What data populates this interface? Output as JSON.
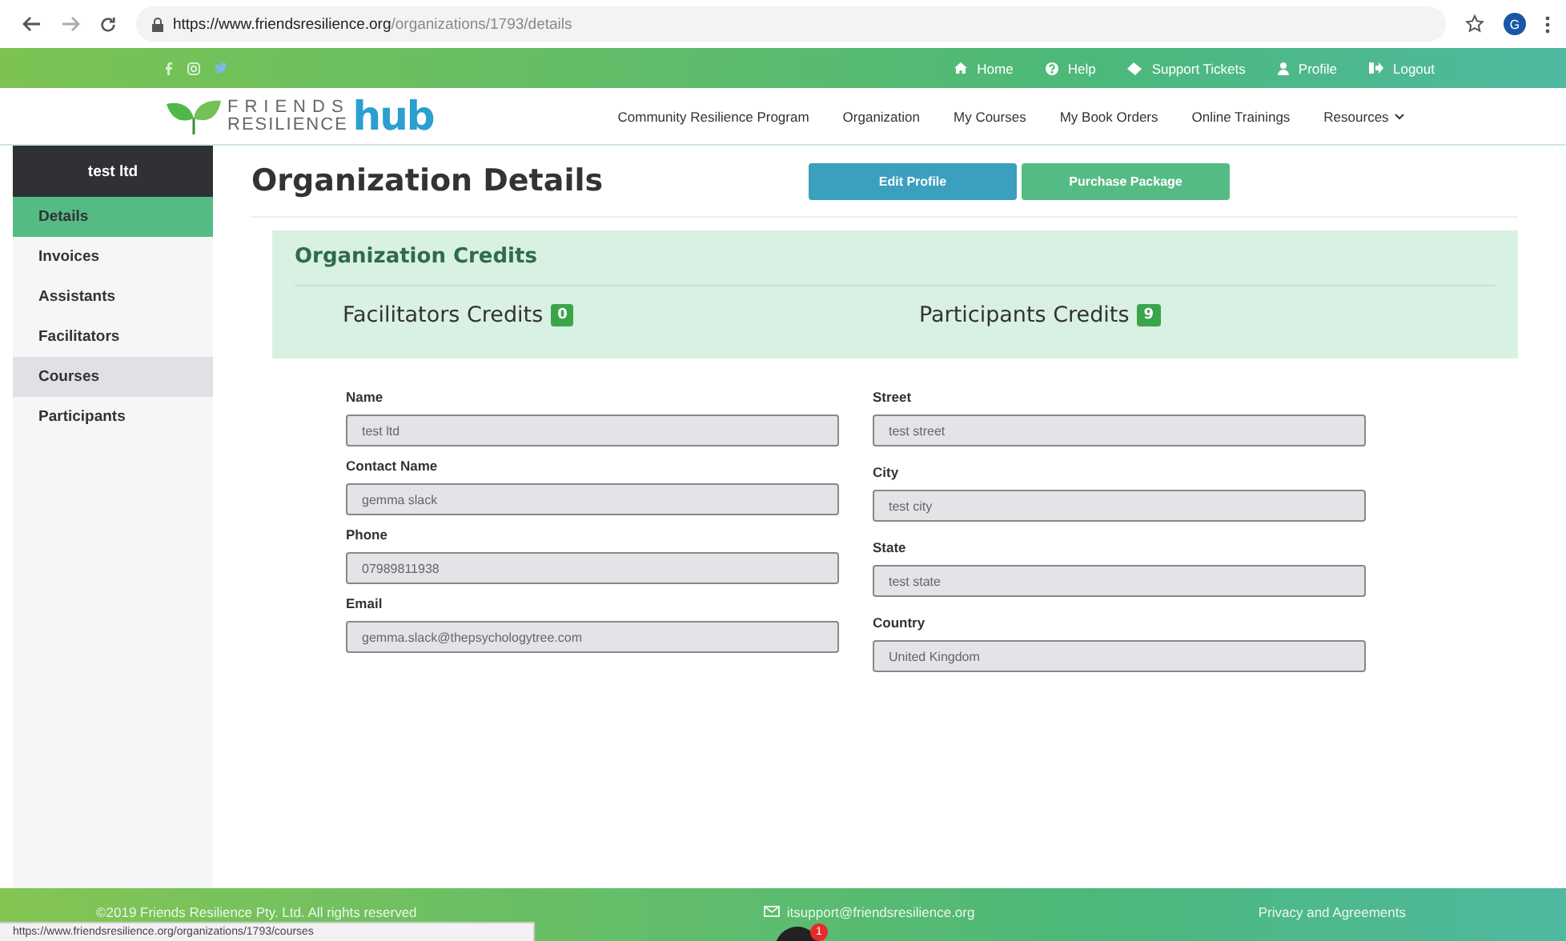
{
  "browser": {
    "url_host": "https://www.friendsresilience.org",
    "url_path": "/organizations/1793/details",
    "avatar": "G"
  },
  "top_bar": {
    "links": [
      {
        "label": "Home"
      },
      {
        "label": "Help"
      },
      {
        "label": "Support Tickets"
      },
      {
        "label": "Profile"
      },
      {
        "label": "Logout"
      }
    ]
  },
  "logo": {
    "line1": "FRIENDS",
    "line2": "RESILIENCE",
    "word": "hub"
  },
  "nav": [
    {
      "label": "Community Resilience Program",
      "dropdown": false
    },
    {
      "label": "Organization",
      "dropdown": false
    },
    {
      "label": "My Courses",
      "dropdown": false
    },
    {
      "label": "My Book Orders",
      "dropdown": false
    },
    {
      "label": "Online Trainings",
      "dropdown": false
    },
    {
      "label": "Resources",
      "dropdown": true
    }
  ],
  "sidebar": {
    "title": "test ltd",
    "items": [
      {
        "label": "Details",
        "selected": true,
        "hovered": false
      },
      {
        "label": "Invoices",
        "selected": false,
        "hovered": false
      },
      {
        "label": "Assistants",
        "selected": false,
        "hovered": false
      },
      {
        "label": "Facilitators",
        "selected": false,
        "hovered": false
      },
      {
        "label": "Courses",
        "selected": false,
        "hovered": true
      },
      {
        "label": "Participants",
        "selected": false,
        "hovered": false
      }
    ]
  },
  "page_title": "Organization Details",
  "buttons": [
    {
      "label": "Edit Profile",
      "kind": "info"
    },
    {
      "label": "Purchase Package",
      "kind": "success"
    }
  ],
  "credits": {
    "title": "Organization Credits",
    "items": [
      {
        "label": "Facilitators Credits",
        "count": "0"
      },
      {
        "label": "Participants Credits",
        "count": "9"
      }
    ]
  },
  "form": {
    "columns": [
      [
        {
          "label": "Name",
          "value": "test ltd"
        },
        {
          "label": "Contact Name",
          "value": "gemma slack"
        },
        {
          "label": "Phone",
          "value": "07989811938"
        },
        {
          "label": "Email",
          "value": "gemma.slack@thepsychologytree.com"
        }
      ],
      [
        {
          "label": "Street",
          "value": "test street"
        },
        {
          "label": "City",
          "value": "test city"
        },
        {
          "label": "State",
          "value": "test state"
        },
        {
          "label": "Country",
          "value": "United Kingdom"
        }
      ]
    ]
  },
  "footer": {
    "copyright": "©2019 Friends Resilience Pty. Ltd. All rights reserved",
    "email": "itsupport@friendsresilience.org",
    "link": "Privacy and Agreements"
  },
  "status_url": "https://www.friendsresilience.org/organizations/1793/courses",
  "chat": {
    "badge": "1"
  }
}
